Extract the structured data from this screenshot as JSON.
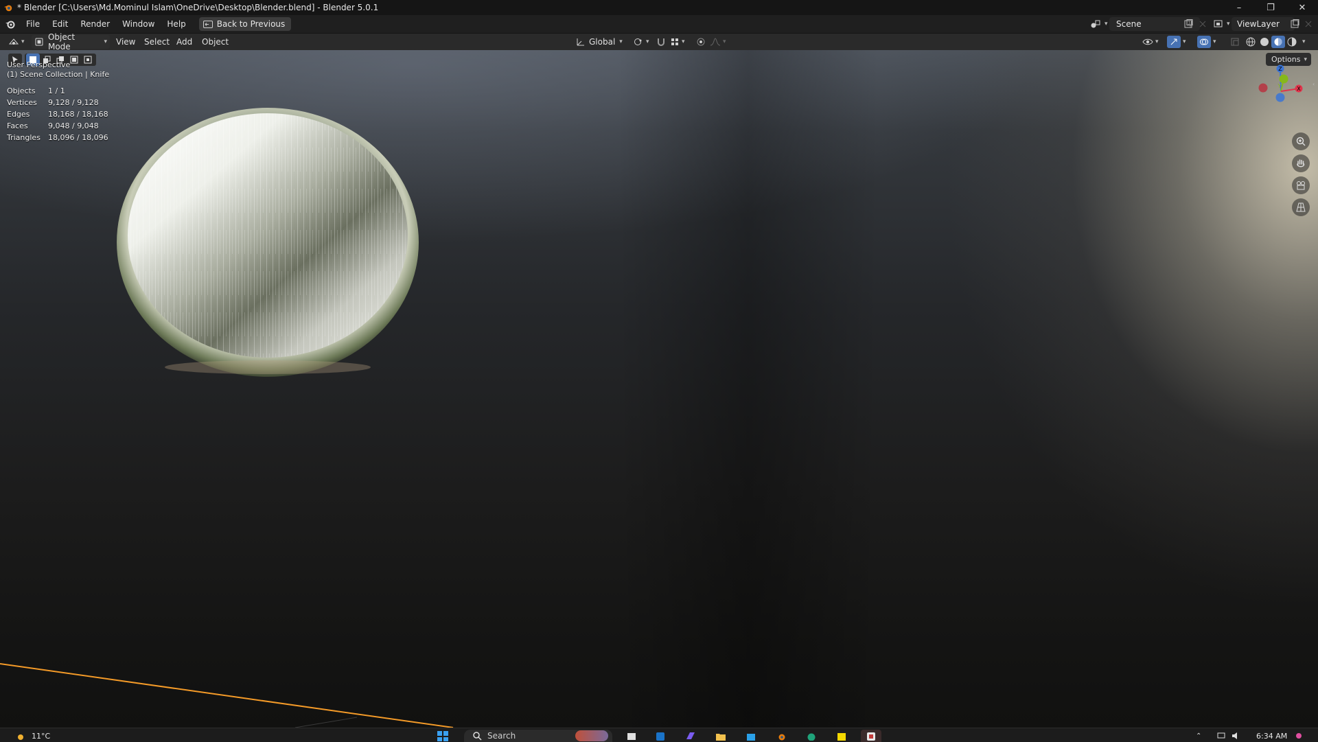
{
  "window": {
    "title": "* Blender [C:\\Users\\Md.Mominul Islam\\OneDrive\\Desktop\\Blender.blend] - Blender 5.0.1",
    "controls": [
      "–",
      "❐",
      "✕"
    ]
  },
  "menubar": {
    "items": [
      "File",
      "Edit",
      "Render",
      "Window",
      "Help"
    ],
    "back_button": "Back to Previous",
    "scene": "Scene",
    "view_layer": "ViewLayer"
  },
  "viewport_header": {
    "mode": "Object Mode",
    "menus": [
      "View",
      "Select",
      "Add",
      "Object"
    ],
    "transform_orientation": "Global"
  },
  "viewport": {
    "view_name": "User Perspective",
    "collection": "(1) Scene Collection | Knife",
    "options_label": "Options",
    "stats": [
      {
        "label": "Objects",
        "value": "1 / 1"
      },
      {
        "label": "Vertices",
        "value": "9,128 / 9,128"
      },
      {
        "label": "Edges",
        "value": "18,168 / 18,168"
      },
      {
        "label": "Faces",
        "value": "9,048 / 9,048"
      },
      {
        "label": "Triangles",
        "value": "18,096 / 18,096"
      }
    ],
    "gizmo": {
      "z": "Z",
      "y": "Y",
      "x": "X"
    },
    "colors": {
      "x_axis": "#e0344b",
      "y_axis": "#86b81a",
      "z_axis": "#3a74d6",
      "selection_outline": "#f59b28"
    }
  },
  "taskbar": {
    "weather": "11°C",
    "search": "Search",
    "time": "6:34 AM"
  }
}
